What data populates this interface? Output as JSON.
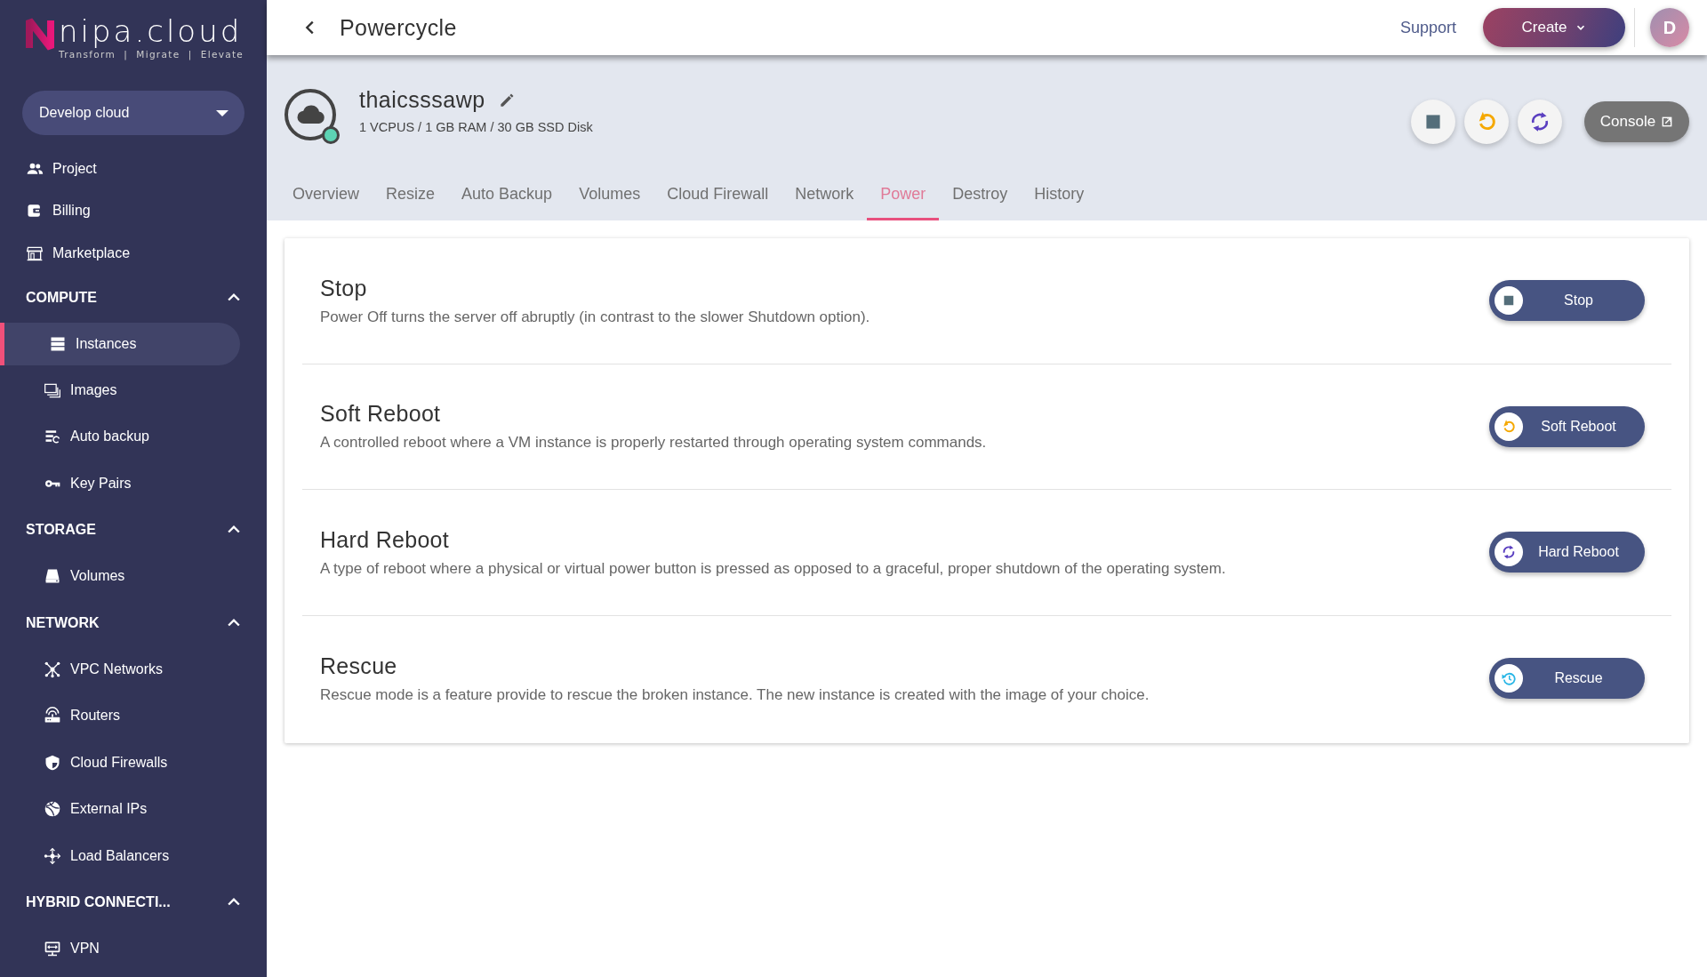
{
  "sidebar": {
    "logo": {
      "name": "nipa.cloud",
      "tagline": "Transform  |  Migrate  |  Elevate"
    },
    "project_selector": "Develop cloud",
    "items": [
      {
        "label": "Project"
      },
      {
        "label": "Billing"
      },
      {
        "label": "Marketplace"
      }
    ],
    "sections": [
      {
        "title": "COMPUTE",
        "expanded": true,
        "items": [
          {
            "label": "Instances",
            "selected": true
          },
          {
            "label": "Images",
            "selected": false
          },
          {
            "label": "Auto backup",
            "selected": false
          },
          {
            "label": "Key Pairs",
            "selected": false
          }
        ]
      },
      {
        "title": "STORAGE",
        "expanded": true,
        "items": [
          {
            "label": "Volumes",
            "selected": false
          }
        ]
      },
      {
        "title": "NETWORK",
        "expanded": true,
        "items": [
          {
            "label": "VPC Networks",
            "selected": false
          },
          {
            "label": "Routers",
            "selected": false
          },
          {
            "label": "Cloud Firewalls",
            "selected": false
          },
          {
            "label": "External IPs",
            "selected": false
          },
          {
            "label": "Load Balancers",
            "selected": false
          }
        ]
      },
      {
        "title": "HYBRID CONNECTI...",
        "expanded": true,
        "items": [
          {
            "label": "VPN",
            "selected": false
          }
        ]
      }
    ]
  },
  "header": {
    "title": "Powercycle",
    "support": "Support",
    "create": "Create",
    "avatar": "D"
  },
  "instance": {
    "name": "thaicsssawp",
    "specs": "1 VCPUS / 1 GB RAM / 30 GB SSD Disk",
    "running": true,
    "console": "Console"
  },
  "tabs": [
    {
      "label": "Overview",
      "selected": false
    },
    {
      "label": "Resize",
      "selected": false
    },
    {
      "label": "Auto Backup",
      "selected": false
    },
    {
      "label": "Volumes",
      "selected": false
    },
    {
      "label": "Cloud Firewall",
      "selected": false
    },
    {
      "label": "Network",
      "selected": false
    },
    {
      "label": "Power",
      "selected": true
    },
    {
      "label": "Destroy",
      "selected": false
    },
    {
      "label": "History",
      "selected": false
    }
  ],
  "power_actions": [
    {
      "title": "Stop",
      "description": "Power Off turns the server off abruptly (in contrast to the slower Shutdown option).",
      "button": "Stop"
    },
    {
      "title": "Soft Reboot",
      "description": "A controlled reboot where a VM instance is properly restarted through operating system commands.",
      "button": "Soft Reboot"
    },
    {
      "title": "Hard Reboot",
      "description": "A type of reboot where a physical or virtual power button is pressed as opposed to a graceful, proper shutdown of the operating system.",
      "button": "Hard Reboot"
    },
    {
      "title": "Rescue",
      "description": "Rescue mode is a feature provide to rescue the broken instance. The new instance is created with the image of your choice.",
      "button": "Rescue"
    }
  ]
}
